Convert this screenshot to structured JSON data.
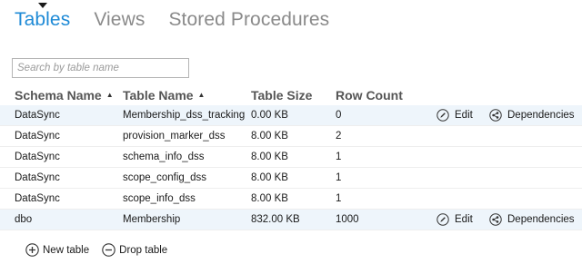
{
  "tabs": [
    {
      "label": "Tables",
      "active": true
    },
    {
      "label": "Views",
      "active": false
    },
    {
      "label": "Stored Procedures",
      "active": false
    }
  ],
  "search": {
    "placeholder": "Search by table name",
    "value": ""
  },
  "columns": {
    "schema": "Schema Name",
    "name": "Table Name",
    "size": "Table Size",
    "rows": "Row Count"
  },
  "sort_indicator": "▲",
  "rows": [
    {
      "schema": "DataSync",
      "name": "Membership_dss_tracking",
      "size": "0.00 KB",
      "rows": "0",
      "edit": "Edit",
      "dependencies": "Dependencies"
    },
    {
      "schema": "DataSync",
      "name": "provision_marker_dss",
      "size": "8.00 KB",
      "rows": "2"
    },
    {
      "schema": "DataSync",
      "name": "schema_info_dss",
      "size": "8.00 KB",
      "rows": "1"
    },
    {
      "schema": "DataSync",
      "name": "scope_config_dss",
      "size": "8.00 KB",
      "rows": "1"
    },
    {
      "schema": "DataSync",
      "name": "scope_info_dss",
      "size": "8.00 KB",
      "rows": "1"
    },
    {
      "schema": "dbo",
      "name": "Membership",
      "size": "832.00 KB",
      "rows": "1000",
      "edit": "Edit",
      "dependencies": "Dependencies"
    }
  ],
  "footer": {
    "new_table": "New table",
    "drop_table": "Drop table"
  },
  "colors": {
    "accent": "#1e8ad6",
    "row_highlight": "#eef5fb",
    "muted_tab": "#8a8a8a"
  }
}
